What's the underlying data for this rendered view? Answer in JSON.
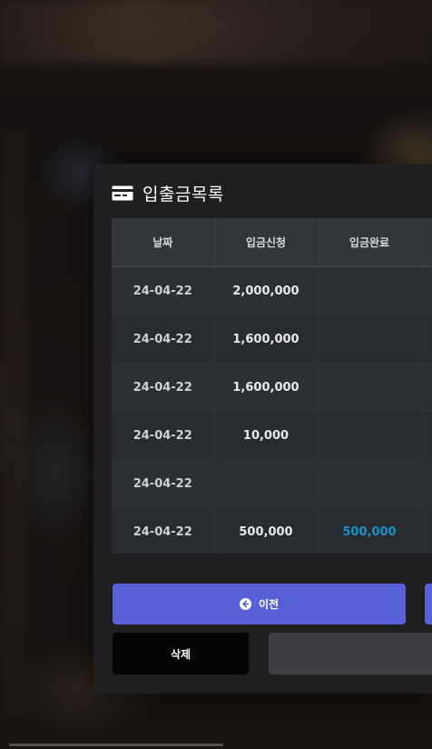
{
  "modal": {
    "title": "입출금목록",
    "title_icon": "card-icon"
  },
  "table": {
    "headers": [
      "날짜",
      "입금신청",
      "입금완료"
    ],
    "rows": [
      {
        "date": "24-04-22",
        "requested": "2,000,000",
        "completed": ""
      },
      {
        "date": "24-04-22",
        "requested": "1,600,000",
        "completed": ""
      },
      {
        "date": "24-04-22",
        "requested": "1,600,000",
        "completed": ""
      },
      {
        "date": "24-04-22",
        "requested": "10,000",
        "completed": ""
      },
      {
        "date": "24-04-22",
        "requested": "",
        "completed": ""
      },
      {
        "date": "24-04-22",
        "requested": "500,000",
        "completed": "500,000"
      }
    ]
  },
  "buttons": {
    "prev_label": "이전",
    "prev_icon": "arrow-left-circle-icon",
    "delete_label": "삭제"
  },
  "colors": {
    "primary": "#5860d8",
    "completed_text": "#1e90c8",
    "modal_bg": "#201f21"
  }
}
